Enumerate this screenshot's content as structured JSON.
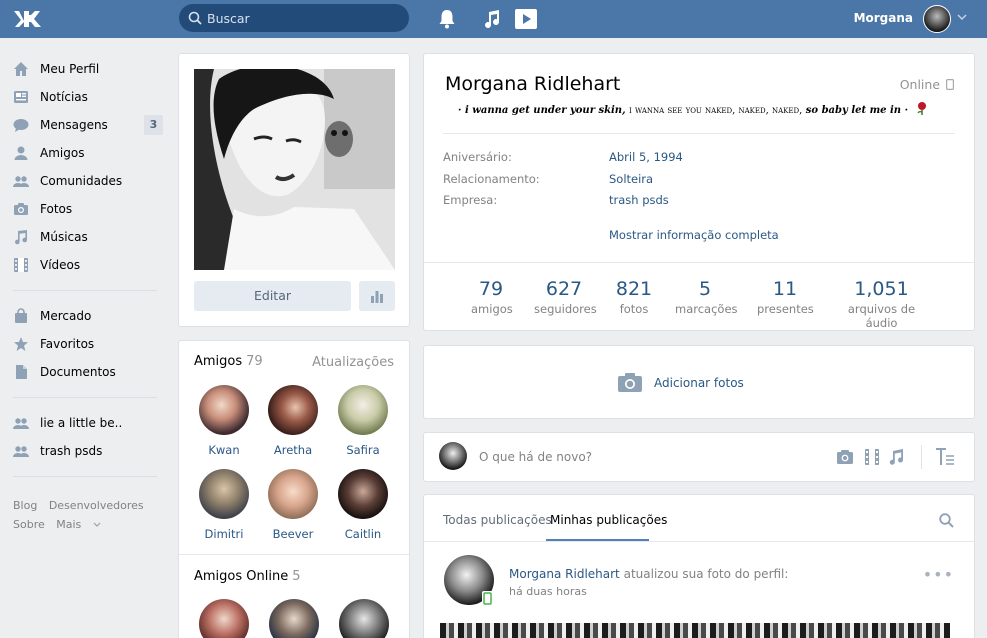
{
  "header": {
    "search_placeholder": "Buscar",
    "user_name": "Morgana"
  },
  "menu": {
    "items": [
      {
        "label": "Meu Perfil",
        "icon": "home-icon"
      },
      {
        "label": "Notícias",
        "icon": "news-icon"
      },
      {
        "label": "Mensagens",
        "icon": "chat-icon",
        "badge": "3"
      },
      {
        "label": "Amigos",
        "icon": "user-icon"
      },
      {
        "label": "Comunidades",
        "icon": "users-icon"
      },
      {
        "label": "Fotos",
        "icon": "camera-icon"
      },
      {
        "label": "Músicas",
        "icon": "music-icon"
      },
      {
        "label": "Vídeos",
        "icon": "film-icon"
      }
    ],
    "items2": [
      {
        "label": "Mercado",
        "icon": "bag-icon"
      },
      {
        "label": "Favoritos",
        "icon": "star-icon"
      },
      {
        "label": "Documentos",
        "icon": "doc-icon"
      }
    ],
    "groups": [
      {
        "label": "lie a little be.."
      },
      {
        "label": "trash psds"
      }
    ]
  },
  "footer": {
    "blog": "Blog",
    "devs": "Desenvolvedores",
    "about": "Sobre",
    "more": "Mais"
  },
  "profile": {
    "edit_label": "Editar",
    "name": "Morgana Ridlehart",
    "online": "Online",
    "status_a": "i wanna get under your skin,",
    "status_b": "i wanna see you naked, naked, naked,",
    "status_c": "so baby let me in",
    "info": [
      {
        "label": "Aniversário:",
        "value": "Abril 5, 1994"
      },
      {
        "label": "Relacionamento:",
        "value": "Solteira"
      },
      {
        "label": "Empresa:",
        "value": "trash psds"
      }
    ],
    "show_more": "Mostrar informação completa",
    "counters": [
      {
        "value": "79",
        "label": "amigos"
      },
      {
        "value": "627",
        "label": "seguidores"
      },
      {
        "value": "821",
        "label": "fotos"
      },
      {
        "value": "5",
        "label": "marcações"
      },
      {
        "value": "11",
        "label": "presentes"
      },
      {
        "value": "1,051",
        "label": "arquivos de áudio"
      }
    ]
  },
  "friends": {
    "title": "Amigos",
    "count": "79",
    "updates": "Atualizações",
    "list": [
      {
        "name": "Kwan"
      },
      {
        "name": "Aretha"
      },
      {
        "name": "Safira"
      },
      {
        "name": "Dimitri"
      },
      {
        "name": "Beever"
      },
      {
        "name": "Caitlin"
      }
    ],
    "online_title": "Amigos Online",
    "online_count": "5"
  },
  "photos": {
    "add_label": "Adicionar fotos"
  },
  "composer": {
    "placeholder": "O que há de novo?"
  },
  "wall": {
    "tab_all": "Todas publicações",
    "tab_mine": "Minhas publicações",
    "post_author": "Morgana Ridlehart",
    "post_action": "atualizou sua foto do perfil:",
    "post_time": "há duas horas"
  },
  "colors": {
    "header": "#4a76a8",
    "link": "#2a5885",
    "background": "#edeef0"
  }
}
